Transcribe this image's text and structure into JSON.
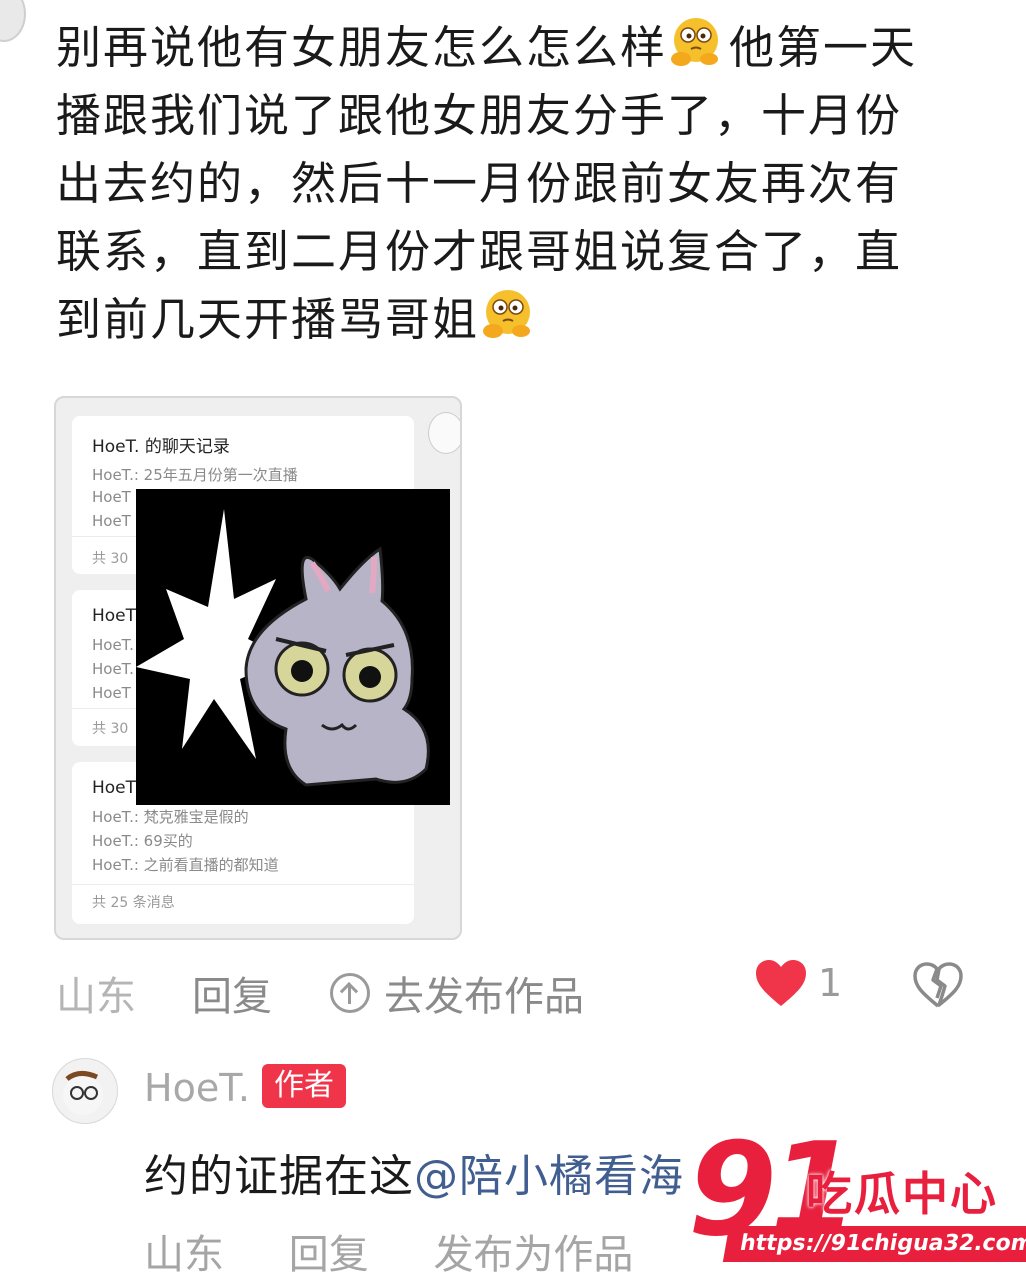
{
  "comment": {
    "line1_a": "别再说他有女朋友怎么怎么样",
    "line1_b": "他第一天",
    "line2": "播跟我们说了跟他女朋友分手了，十月份",
    "line3": "出去约的，然后十一月份跟前女友再次有",
    "line4": "联系，直到二月份才跟哥姐说复合了，直",
    "line5": "到前几天开播骂哥姐",
    "emoji": "thinking-face-emoji"
  },
  "screenshot": {
    "records": [
      {
        "title": "HoeT. 的聊天记录",
        "lines": [
          "HoeT.: 25年五月份第一次直播",
          "HoeT",
          "HoeT"
        ],
        "count": "共 30"
      },
      {
        "title": "HoeT",
        "lines": [
          "HoeT.",
          "HoeT.",
          "HoeT"
        ],
        "count": "共 30"
      },
      {
        "title": "HoeT",
        "lines": [
          "HoeT.: 梵克雅宝是假的",
          "HoeT.: 69买的",
          "HoeT.: 之前看直播的都知道"
        ],
        "count": "共 25 条消息"
      }
    ],
    "sticker": "angry-cat-sticker"
  },
  "actions": {
    "location": "山东",
    "reply": "回复",
    "publish": "去发布作品",
    "like_count": "1",
    "like_color": "#f0354a"
  },
  "reply": {
    "name": "HoeT.",
    "badge": "作者",
    "text_plain": "约的证据在这",
    "mention": "@陪小橘看海",
    "location": "山东",
    "reply_label": "回复",
    "publish_label": "发布为作品"
  },
  "watermark": {
    "number": "91",
    "name": "吃瓜中心",
    "url": "https://91chigua32.com"
  }
}
